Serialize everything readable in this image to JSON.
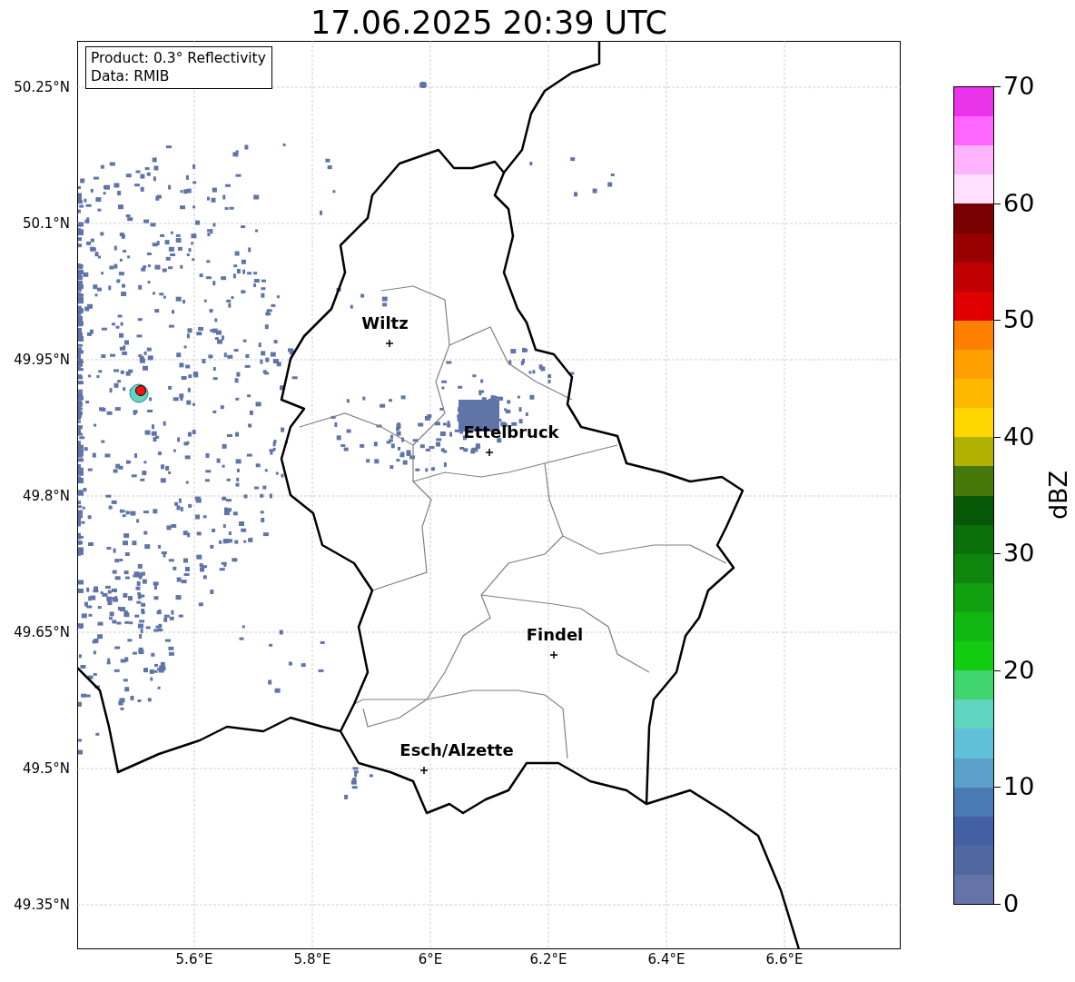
{
  "title": "17.06.2025 20:39 UTC",
  "info_box": {
    "lines": [
      "Product: 0.3° Reflectivity",
      "Data: RMIB"
    ]
  },
  "map": {
    "lat_ticks": [
      "50.25°N",
      "50.1°N",
      "49.95°N",
      "49.8°N",
      "49.65°N",
      "49.5°N",
      "49.35°N"
    ],
    "lon_ticks": [
      "5.6°E",
      "5.8°E",
      "6°E",
      "6.2°E",
      "6.4°E",
      "6.6°E"
    ],
    "cities": [
      {
        "name": "Wiltz"
      },
      {
        "name": "Ettelbruck"
      },
      {
        "name": "Findel"
      },
      {
        "name": "Esch/Alzette"
      }
    ]
  },
  "colorbar": {
    "label": "dBZ",
    "ticks": [
      "70",
      "60",
      "50",
      "40",
      "30",
      "20",
      "10",
      "0"
    ],
    "segments": [
      {
        "color": "#ea33ea"
      },
      {
        "color": "#ff66ff"
      },
      {
        "color": "#ffb3ff"
      },
      {
        "color": "#ffe0ff"
      },
      {
        "color": "#780000"
      },
      {
        "color": "#9a0000"
      },
      {
        "color": "#c00000"
      },
      {
        "color": "#e00000"
      },
      {
        "color": "#ff8000"
      },
      {
        "color": "#ff9f00"
      },
      {
        "color": "#ffb800"
      },
      {
        "color": "#ffd700"
      },
      {
        "color": "#b0b000"
      },
      {
        "color": "#457808"
      },
      {
        "color": "#065806"
      },
      {
        "color": "#0a700a"
      },
      {
        "color": "#0e860e"
      },
      {
        "color": "#10a010"
      },
      {
        "color": "#12b812"
      },
      {
        "color": "#12cc12"
      },
      {
        "color": "#3fd46d"
      },
      {
        "color": "#60d6c0"
      },
      {
        "color": "#60c0d8"
      },
      {
        "color": "#5aa0c8"
      },
      {
        "color": "#4a7ab4"
      },
      {
        "color": "#4460a4"
      },
      {
        "color": "#5068a0"
      },
      {
        "color": "#6474a8"
      }
    ]
  }
}
